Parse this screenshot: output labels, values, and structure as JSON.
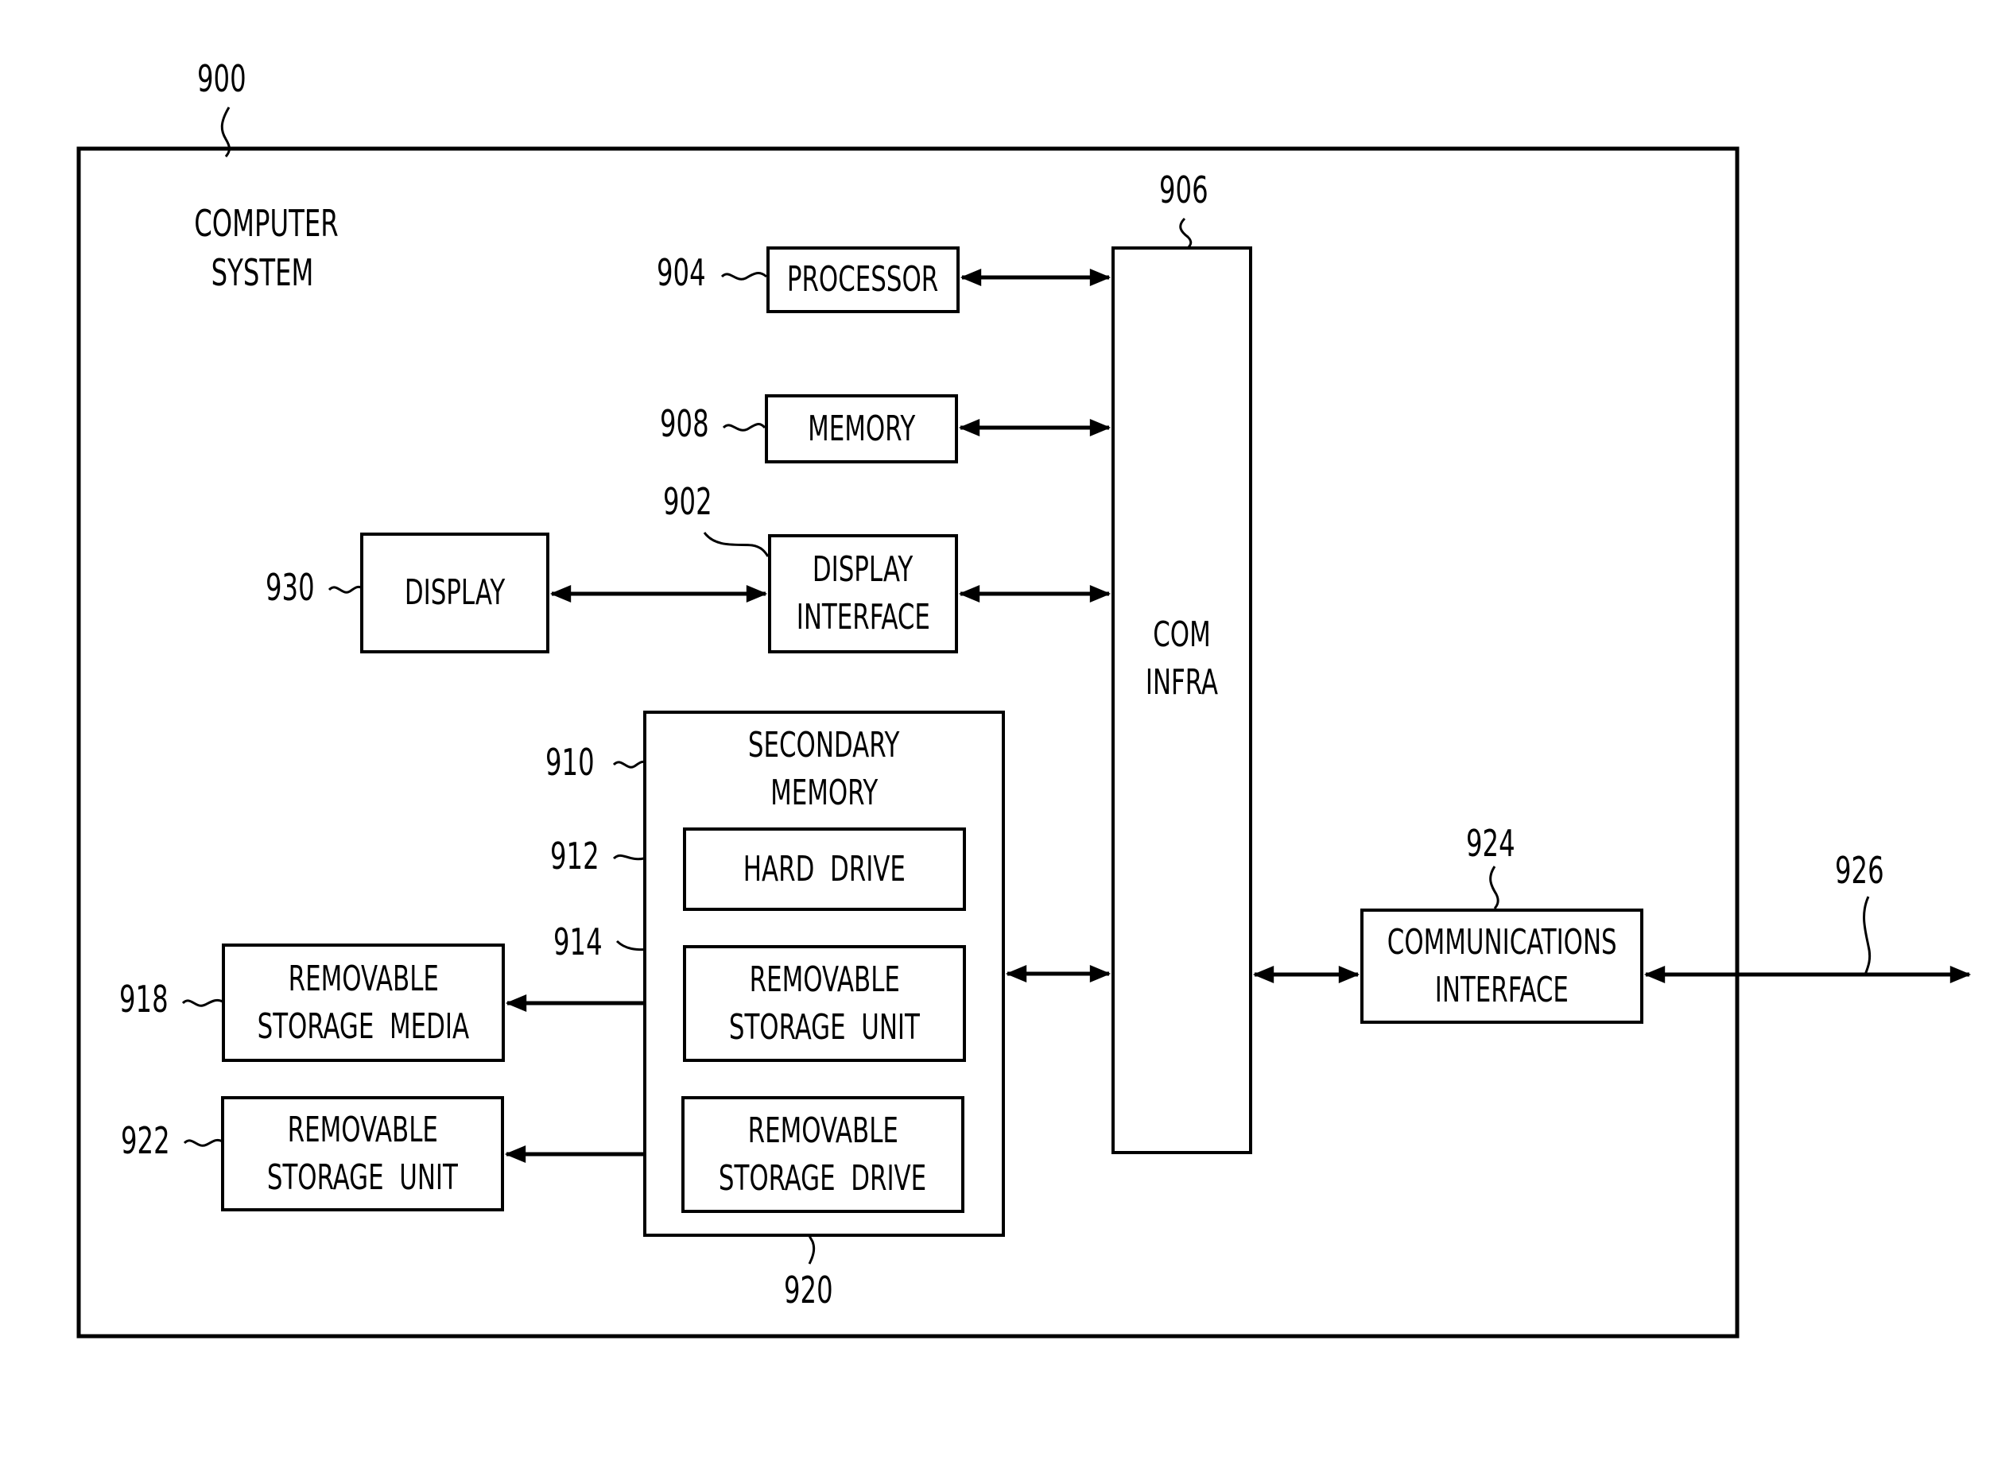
{
  "figure": {
    "system_ref": "900",
    "system_label_line1": "COMPUTER",
    "system_label_line2": "SYSTEM"
  },
  "blocks": {
    "processor": {
      "ref": "904",
      "label": "PROCESSOR"
    },
    "memory": {
      "ref": "908",
      "label": "MEMORY"
    },
    "display_interface": {
      "ref": "902",
      "line1": "DISPLAY",
      "line2": "INTERFACE"
    },
    "display": {
      "ref": "930",
      "label": "DISPLAY"
    },
    "com_infra": {
      "ref": "906",
      "line1": "COM",
      "line2": "INFRA"
    },
    "secondary_memory": {
      "ref": "910",
      "line1": "SECONDARY",
      "line2": "MEMORY"
    },
    "hard_drive": {
      "ref": "912",
      "label": "HARD  DRIVE"
    },
    "removable_storage_unit_inner": {
      "ref": "914",
      "line1": "REMOVABLE",
      "line2": "STORAGE  UNIT"
    },
    "removable_storage_drive": {
      "ref": "920",
      "line1": "REMOVABLE",
      "line2": "STORAGE  DRIVE"
    },
    "removable_storage_media": {
      "ref": "918",
      "line1": "REMOVABLE",
      "line2": "STORAGE  MEDIA"
    },
    "removable_storage_unit_outer": {
      "ref": "922",
      "line1": "REMOVABLE",
      "line2": "STORAGE  UNIT"
    },
    "communications_interface": {
      "ref": "924",
      "line1": "COMMUNICATIONS",
      "line2": "INTERFACE"
    },
    "communications_path": {
      "ref": "926"
    }
  }
}
